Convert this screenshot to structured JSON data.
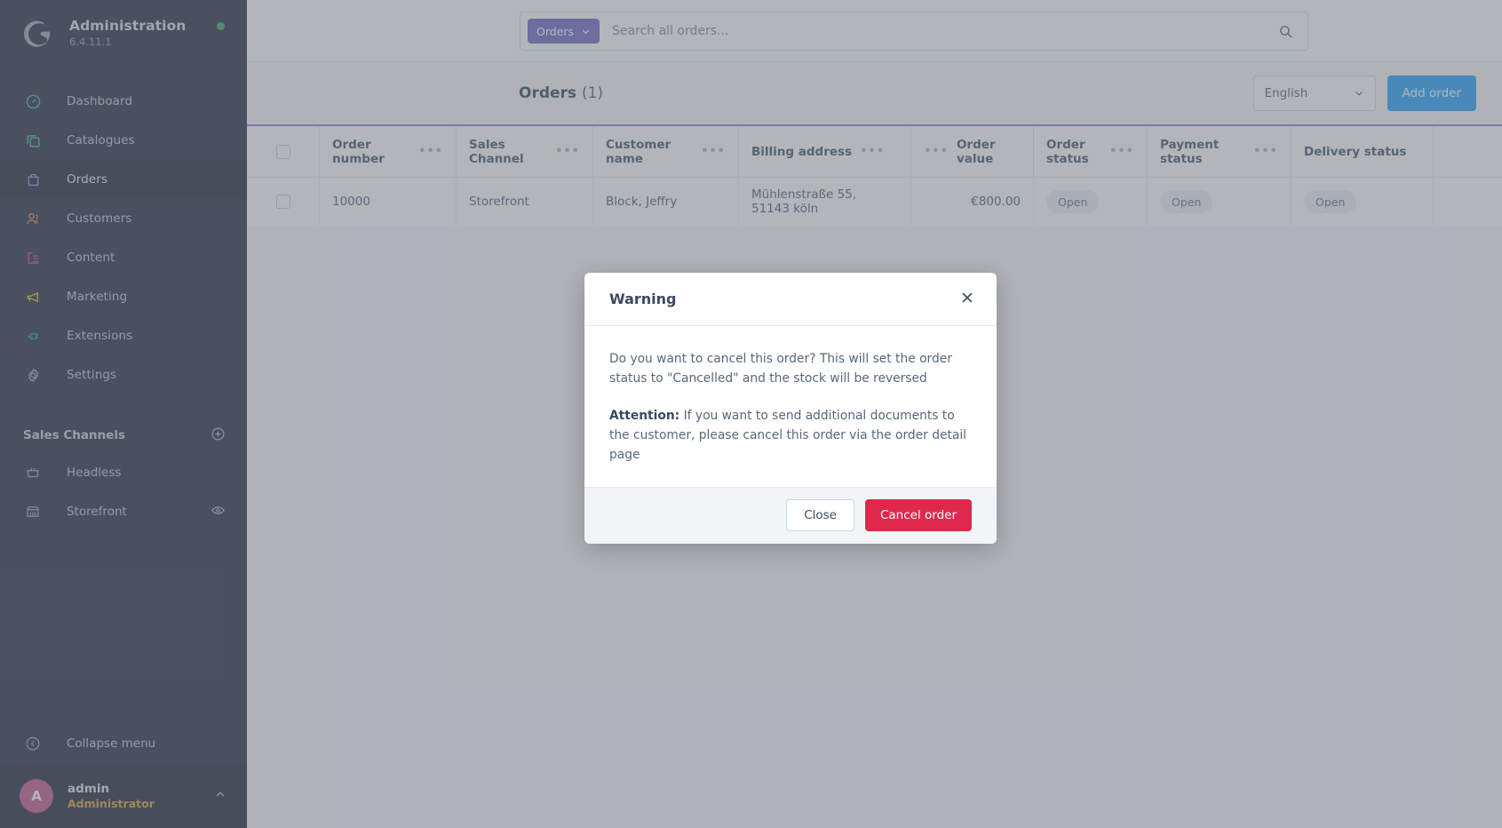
{
  "sidebar": {
    "brand": {
      "title": "Administration",
      "version": "6.4.11.1",
      "logo_icon": "shopware-logo",
      "status_icon": "status-dot"
    },
    "items": [
      {
        "label": "Dashboard",
        "icon": "gauge-icon",
        "color": "#37a9c5",
        "active": false
      },
      {
        "label": "Catalogues",
        "icon": "copy-icon",
        "color": "#3cba82",
        "active": false
      },
      {
        "label": "Orders",
        "icon": "bag-icon",
        "color": "#9b7fe0",
        "active": true
      },
      {
        "label": "Customers",
        "icon": "users-icon",
        "color": "#e07b3c",
        "active": false
      },
      {
        "label": "Content",
        "icon": "content-icon",
        "color": "#d6347e",
        "active": false
      },
      {
        "label": "Marketing",
        "icon": "megaphone-icon",
        "color": "#e8c01f",
        "active": false
      },
      {
        "label": "Extensions",
        "icon": "plug-icon",
        "color": "#1d7fd4",
        "active": false
      },
      {
        "label": "Settings",
        "icon": "gear-icon",
        "color": "#97a1b0",
        "active": false
      }
    ],
    "sales_channels": {
      "title": "Sales Channels",
      "add_icon": "plus-circle-icon",
      "items": [
        {
          "label": "Headless",
          "icon": "basket-icon",
          "trailing_icon": ""
        },
        {
          "label": "Storefront",
          "icon": "store-icon",
          "trailing_icon": "eye-icon"
        }
      ]
    },
    "collapse": {
      "label": "Collapse menu",
      "icon": "chevron-left-circle-icon"
    },
    "user": {
      "initial": "A",
      "name": "admin",
      "role": "Administrator",
      "chevron_icon": "chevron-up-icon"
    }
  },
  "search": {
    "scope_label": "Orders",
    "scope_chevron_icon": "chevron-down-icon",
    "placeholder": "Search all orders...",
    "value": "",
    "submit_icon": "search-icon"
  },
  "page": {
    "title": "Orders",
    "count": "(1)",
    "language": "English",
    "language_chevron_icon": "chevron-down-icon",
    "add_button": "Add order"
  },
  "table": {
    "select_all_icon": "checkbox-unchecked",
    "column_menu_icon": "ellipsis-icon",
    "columns": [
      {
        "label": "Order number",
        "align": "left",
        "menu": true
      },
      {
        "label": "Sales Channel",
        "align": "left",
        "menu": true
      },
      {
        "label": "Customer name",
        "align": "left",
        "menu": true
      },
      {
        "label": "Billing address",
        "align": "left",
        "menu": true
      },
      {
        "label": "Order value",
        "align": "right",
        "menu": true
      },
      {
        "label": "Order status",
        "align": "left",
        "menu": true
      },
      {
        "label": "Payment status",
        "align": "left",
        "menu": true
      },
      {
        "label": "Delivery status",
        "align": "left",
        "menu": false
      }
    ],
    "rows": [
      {
        "checkbox_icon": "checkbox-unchecked",
        "order_number": "10000",
        "sales_channel": "Storefront",
        "customer_name": "Block, Jeffry",
        "billing_address": "Mühlenstraße 55, 51143 köln",
        "order_value": "€800.00",
        "order_status": "Open",
        "payment_status": "Open",
        "delivery_status": "Open"
      }
    ]
  },
  "modal": {
    "title": "Warning",
    "close_icon": "close-icon",
    "paragraph1": "Do you want to cancel this order? This will set the order status to \"Cancelled\" and the stock will be reversed",
    "attention_label": "Attention:",
    "paragraph2": " If you want to send additional documents to the customer, please cancel this order via the order detail page",
    "close_button": "Close",
    "confirm_button": "Cancel order"
  },
  "colors": {
    "sidebar_bg": "#18233a",
    "sidebar_active": "#111b2e",
    "accent_purple": "#6c5ec4",
    "primary_blue": "#189eff",
    "danger_red": "#de294c",
    "table_top_border": "#8b7fd4",
    "avatar_pink": "#bc5082",
    "role_orange": "#d79a2b",
    "status_green": "#26a65a"
  }
}
